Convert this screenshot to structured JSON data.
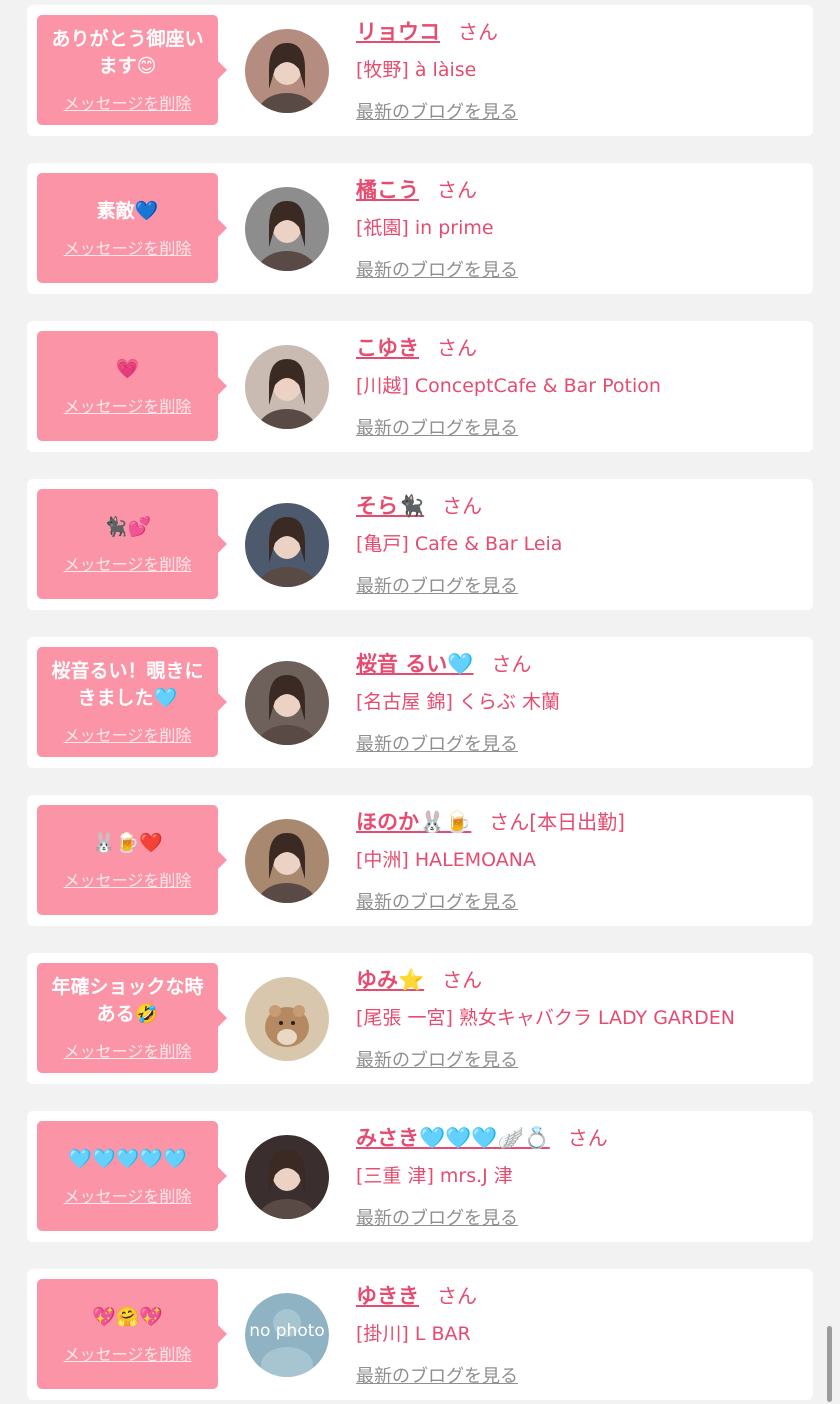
{
  "theme": {
    "accent": "#e54c70",
    "bubble": "#fb94a6",
    "background": "#f2f2f2"
  },
  "cards": [
    {
      "message": "ありがとう御座います😊",
      "delete_label": "メッセージを削除",
      "name": "リョウコ",
      "suffix": "さん",
      "shop": "[牧野] à làise",
      "blog_label": "最新のブログを見る",
      "avatar_icon": "user-photo",
      "avatar_color": "#b48d80"
    },
    {
      "message": "素敵💙",
      "delete_label": "メッセージを削除",
      "name": "橘こう",
      "suffix": "さん",
      "shop": "[祇園] in prime",
      "blog_label": "最新のブログを見る",
      "avatar_icon": "user-photo",
      "avatar_color": "#8d8d8d"
    },
    {
      "message": "💗",
      "delete_label": "メッセージを削除",
      "name": "こゆき",
      "suffix": "さん",
      "shop": "[川越] ConceptCafe & Bar Potion",
      "blog_label": "最新のブログを見る",
      "avatar_icon": "user-photo",
      "avatar_color": "#c9bbb2"
    },
    {
      "message": "🐈‍⬛💕",
      "delete_label": "メッセージを削除",
      "name": "そら🐈‍⬛",
      "suffix": "さん",
      "shop": "[亀戸] Cafe & Bar Leia",
      "blog_label": "最新のブログを見る",
      "avatar_icon": "user-photo",
      "avatar_color": "#4d5a6e"
    },
    {
      "message": "桜音るい！覗きにきました🩵",
      "delete_label": "メッセージを削除",
      "name": "桜音 るい🩵",
      "suffix": "さん",
      "shop": "[名古屋 錦] くらぶ 木蘭",
      "blog_label": "最新のブログを見る",
      "avatar_icon": "user-photo",
      "avatar_color": "#6e605a"
    },
    {
      "message": "🐰🍺❤️",
      "delete_label": "メッセージを削除",
      "name": "ほのか🐰🍺",
      "suffix": "さん[本日出勤]",
      "shop": "[中洲] HALEMOANA",
      "blog_label": "最新のブログを見る",
      "avatar_icon": "user-photo",
      "avatar_color": "#a98870"
    },
    {
      "message": "年確ショックな時ある🤣",
      "delete_label": "メッセージを削除",
      "name": "ゆみ⭐️",
      "suffix": "さん",
      "shop": "[尾張 一宮] 熟女キャバクラ LADY GARDEN",
      "blog_label": "最新のブログを見る",
      "avatar_icon": "hamster-photo",
      "avatar_color": "#d9c7ad"
    },
    {
      "message": "🩵🩵🩵🩵🩵",
      "delete_label": "メッセージを削除",
      "name": "みさき🩵🩵🩵🪽💍",
      "suffix": "さん",
      "shop": "[三重 津] mrs.J 津",
      "blog_label": "最新のブログを見る",
      "avatar_icon": "user-photo",
      "avatar_color": "#3a2e2e"
    },
    {
      "message": "💖🤗💖",
      "delete_label": "メッセージを削除",
      "name": "ゆきき",
      "suffix": "さん",
      "shop": "[掛川] L BAR",
      "blog_label": "最新のブログを見る",
      "avatar_icon": "no-photo",
      "avatar_color": "#8fb3c3",
      "avatar_text": "no photo"
    }
  ]
}
